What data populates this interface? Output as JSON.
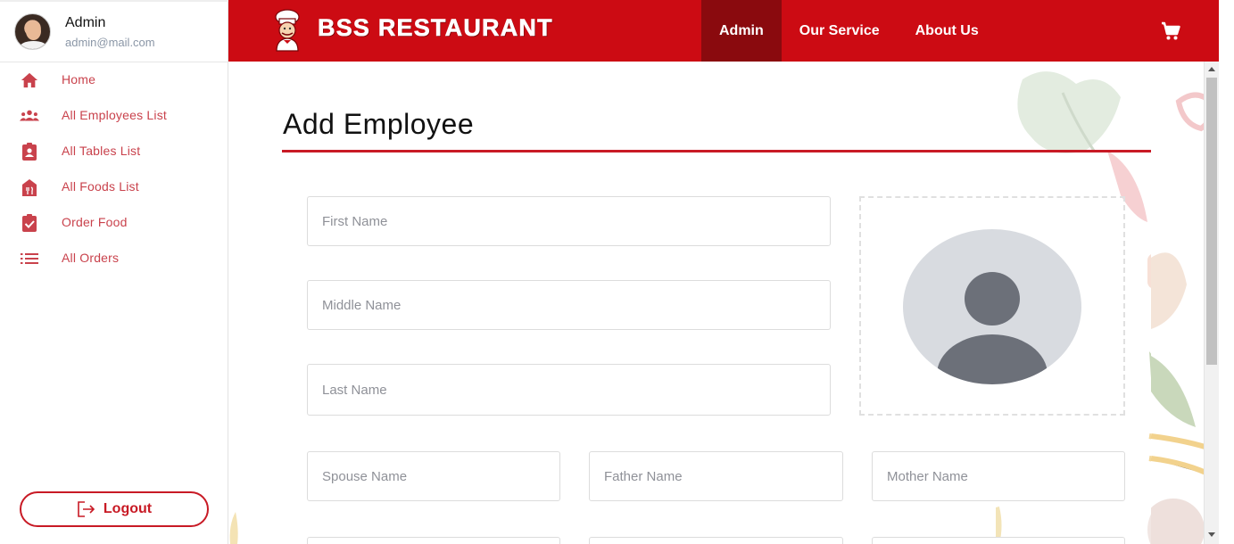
{
  "sidebar": {
    "profile": {
      "name": "Admin",
      "email": "admin@mail.com"
    },
    "items": [
      {
        "label": "Home",
        "icon": "home-icon"
      },
      {
        "label": "All Employees List",
        "icon": "people-group-icon"
      },
      {
        "label": "All Tables List",
        "icon": "badge-icon"
      },
      {
        "label": "All Foods List",
        "icon": "restaurant-store-icon"
      },
      {
        "label": "Order Food",
        "icon": "clipboard-check-icon"
      },
      {
        "label": "All Orders",
        "icon": "list-icon"
      }
    ],
    "logout_label": "Logout"
  },
  "header": {
    "brand": "BSS RESTAURANT",
    "nav": [
      {
        "label": "Admin",
        "active": true
      },
      {
        "label": "Our Service",
        "active": false
      },
      {
        "label": "About Us",
        "active": false
      }
    ],
    "cart_icon": "cart-icon"
  },
  "main": {
    "title": "Add Employee",
    "fields": {
      "first_name": "First Name",
      "middle_name": "Middle Name",
      "last_name": "Last Name",
      "spouse_name": "Spouse Name",
      "father_name": "Father Name",
      "mother_name": "Mother Name"
    }
  },
  "colors": {
    "brand_red": "#cc0b13",
    "active_nav": "#8a0a0e",
    "sidebar_text": "#c9424c",
    "title_rule": "#c81a25"
  }
}
